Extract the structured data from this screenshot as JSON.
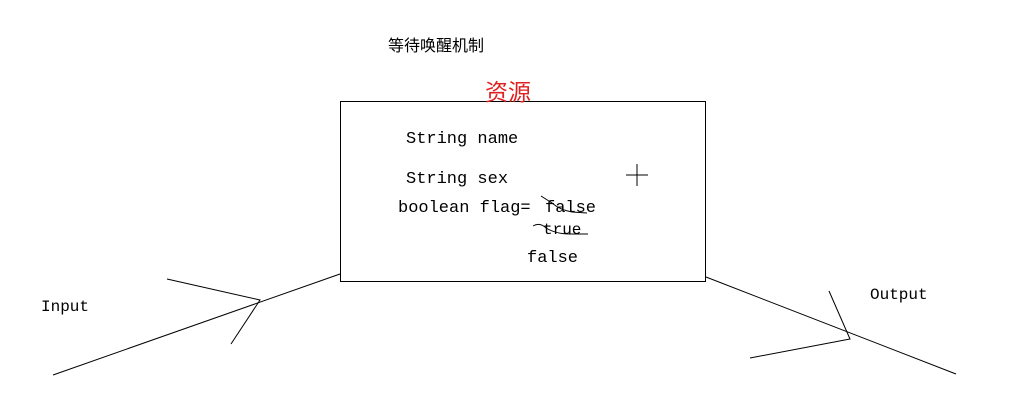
{
  "title": "等待唤醒机制",
  "resource_label": "资源",
  "fields": {
    "name": "String name",
    "sex": "String sex",
    "flag_decl": "boolean flag=",
    "flag_value_1": "false",
    "flag_value_2": "true",
    "flag_value_3": "false"
  },
  "input_label": "Input",
  "output_label": "Output",
  "colors": {
    "resource_label": "#e02020",
    "ink": "#000000"
  }
}
